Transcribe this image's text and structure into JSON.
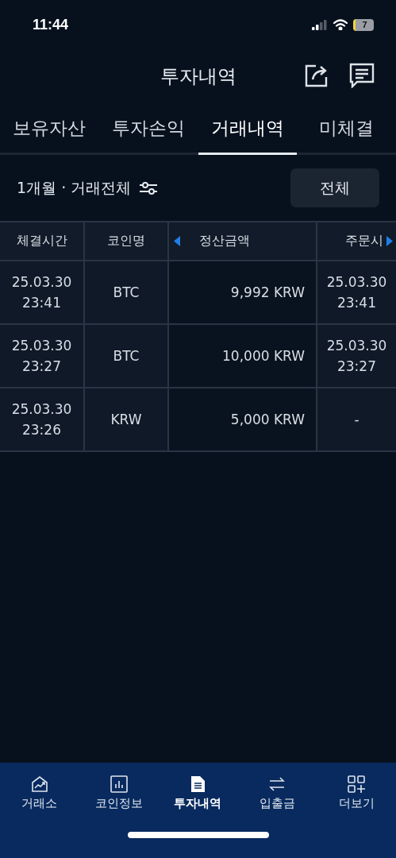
{
  "status_bar": {
    "time": "11:44",
    "battery": "7"
  },
  "header": {
    "title": "투자내역"
  },
  "tabs": [
    {
      "label": "보유자산",
      "selected": false
    },
    {
      "label": "투자손익",
      "selected": false
    },
    {
      "label": "거래내역",
      "selected": true
    },
    {
      "label": "미체결",
      "selected": false
    }
  ],
  "filter": {
    "label": "1개월 · 거래전체",
    "button": "전체"
  },
  "table": {
    "columns": [
      "체결시간",
      "코인명",
      "정산금액",
      "주문시"
    ],
    "rows": [
      {
        "cells": [
          "25.03.30\n23:41",
          "BTC",
          "9,992 KRW",
          "25.03.30\n23:41"
        ]
      },
      {
        "cells": [
          "25.03.30\n23:27",
          "BTC",
          "10,000 KRW",
          "25.03.30\n23:27"
        ]
      },
      {
        "cells": [
          "25.03.30\n23:26",
          "KRW",
          "5,000 KRW",
          "-"
        ]
      }
    ]
  },
  "bottom_nav": [
    {
      "label": "거래소",
      "kind": "exchange",
      "selected": false
    },
    {
      "label": "코인정보",
      "kind": "chart",
      "selected": false
    },
    {
      "label": "투자내역",
      "kind": "document",
      "selected": true
    },
    {
      "label": "입출금",
      "kind": "transfer",
      "selected": false
    },
    {
      "label": "더보기",
      "kind": "more",
      "selected": false
    }
  ]
}
